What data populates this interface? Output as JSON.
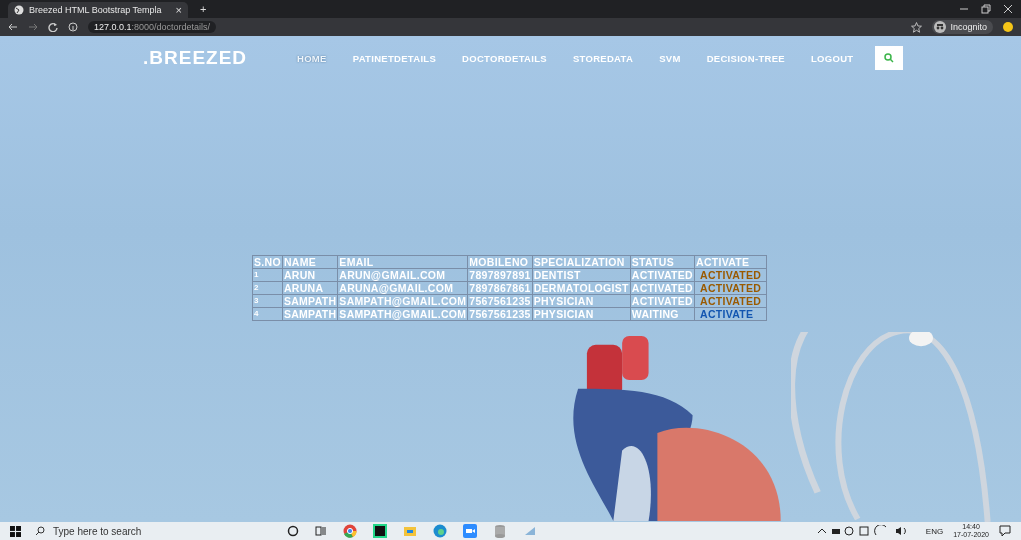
{
  "browser": {
    "tab_title": "Breezed HTML Bootstrap Templa",
    "tab_close": "×",
    "new_tab": "+",
    "url_host": "127.0.0.1",
    "url_path": ":8000/doctordetails/",
    "profile": "Incognito"
  },
  "nav": {
    "logo": ".BREEZED",
    "items": [
      {
        "label": "HOME",
        "selected": true
      },
      {
        "label": "PATINETDETAILS",
        "selected": false
      },
      {
        "label": "DOCTORDETAILS",
        "selected": false
      },
      {
        "label": "STOREDATA",
        "selected": false
      },
      {
        "label": "SVM",
        "selected": false
      },
      {
        "label": "DECISION-TREE",
        "selected": false
      },
      {
        "label": "LOGOUT",
        "selected": false
      }
    ]
  },
  "table": {
    "columns": [
      "S.NO",
      "NAME",
      "EMAIL",
      "MOBILENO",
      "SPECIALIZATION",
      "STATUS",
      "ACTIVATE"
    ],
    "rows": [
      {
        "sno": "1",
        "name": "ARUN",
        "email": "ARUN@GMAIL.COM",
        "mobile": "7897897891",
        "specialization": "DENTIST",
        "status": "ACTIVATED",
        "action": "ACTIVATED",
        "activated": true
      },
      {
        "sno": "2",
        "name": "ARUNA",
        "email": "ARUNA@GMAIL.COM",
        "mobile": "7897867861",
        "specialization": "DERMATOLOGIST",
        "status": "ACTIVATED",
        "action": "ACTIVATED",
        "activated": true
      },
      {
        "sno": "3",
        "name": "SAMPATH",
        "email": "SAMPATH@GMAIL.COM",
        "mobile": "7567561235",
        "specialization": "PHYSICIAN",
        "status": "ACTIVATED",
        "action": "ACTIVATED",
        "activated": true
      },
      {
        "sno": "4",
        "name": "SAMPATH",
        "email": "SAMPATH@GMAIL.COM",
        "mobile": "7567561235",
        "specialization": "PHYSICIAN",
        "status": "WAITING",
        "action": "ACTIVATE",
        "activated": false
      }
    ]
  },
  "taskbar": {
    "search_placeholder": "Type here to search",
    "language": "ENG",
    "time": "14:40",
    "date": "17-07-2020"
  }
}
